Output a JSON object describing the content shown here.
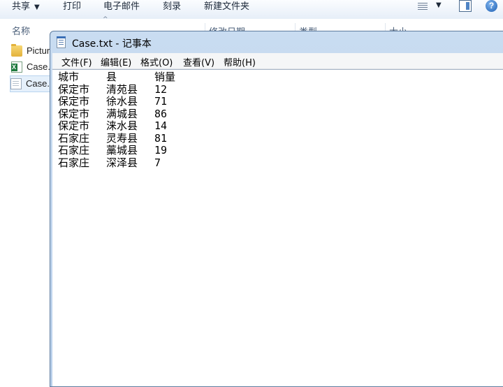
{
  "toolbar": {
    "share_label": "共享",
    "print_label": "打印",
    "email_label": "电子邮件",
    "burn_label": "刻录",
    "new_folder_label": "新建文件夹",
    "help_label": "?"
  },
  "columns": {
    "name": "名称",
    "date": "修改日期",
    "type": "类型",
    "size": "大小"
  },
  "files": [
    {
      "label": "Pictur",
      "icon": "folder-icon"
    },
    {
      "label": "Case.",
      "icon": "excel-file-icon"
    },
    {
      "label": "Case.",
      "icon": "text-file-icon",
      "selected": true
    }
  ],
  "notepad": {
    "title": "Case.txt - 记事本",
    "menu": [
      "文件(F)",
      "编辑(E)",
      "格式(O)",
      "查看(V)",
      "帮助(H)"
    ],
    "header": [
      "城市",
      "县",
      "销量"
    ],
    "rows": [
      [
        "保定市",
        "清苑县",
        "12"
      ],
      [
        "保定市",
        "徐水县",
        "71"
      ],
      [
        "保定市",
        "满城县",
        "86"
      ],
      [
        "保定市",
        "涞水县",
        "14"
      ],
      [
        "石家庄",
        "灵寿县",
        "81"
      ],
      [
        "石家庄",
        "藁城县",
        "19"
      ],
      [
        "石家庄",
        "深泽县",
        "7"
      ]
    ]
  },
  "colors": {
    "toolbar_bg": "#e6eef8",
    "window_frame": "#b7cee9",
    "selection": "#e5f0fb"
  }
}
